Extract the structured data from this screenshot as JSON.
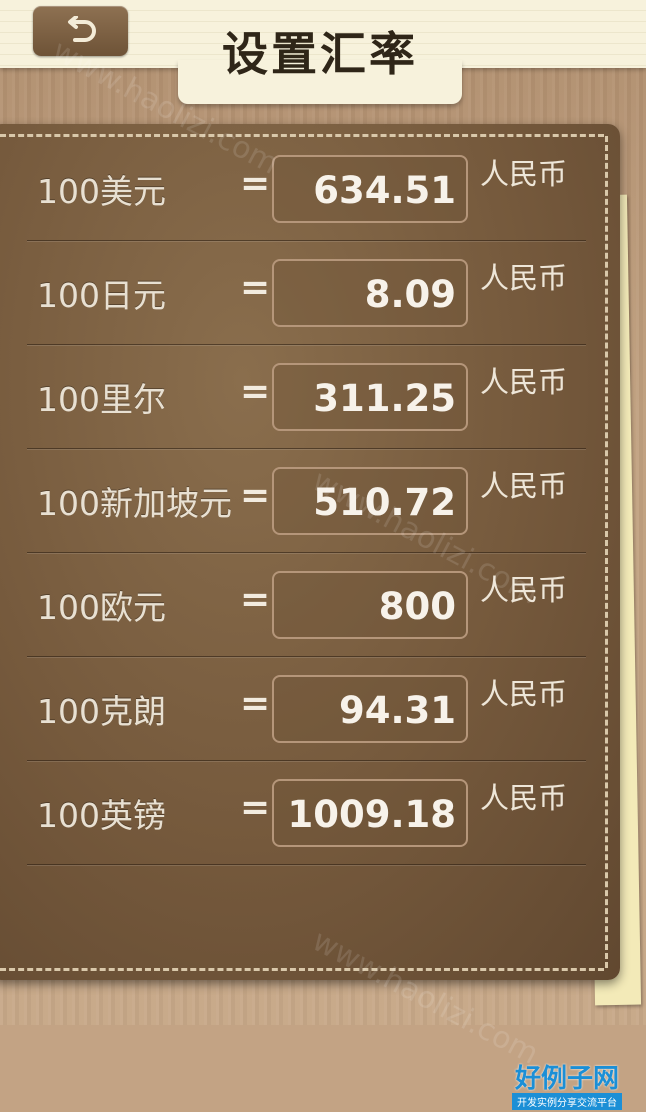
{
  "header": {
    "title": "设置汇率",
    "back_icon": "back-arrow-icon"
  },
  "rates": [
    {
      "currency": "100美元",
      "equals": "=",
      "value": "634.51",
      "unit": "人民币"
    },
    {
      "currency": "100日元",
      "equals": "=",
      "value": "8.09",
      "unit": "人民币"
    },
    {
      "currency": "100里尔",
      "equals": "=",
      "value": "311.25",
      "unit": "人民币"
    },
    {
      "currency": "100新加坡元",
      "equals": "=",
      "value": "510.72",
      "unit": "人民币"
    },
    {
      "currency": "100欧元",
      "equals": "=",
      "value": "800",
      "unit": "人民币"
    },
    {
      "currency": "100克朗",
      "equals": "=",
      "value": "94.31",
      "unit": "人民币"
    },
    {
      "currency": "100英镑",
      "equals": "=",
      "value": "1009.18",
      "unit": "人民币"
    }
  ],
  "watermark": "www.haolizi.com",
  "brand": {
    "name": "好例子网",
    "tagline": "开发实例分享交流平台"
  },
  "colors": {
    "leather": "#75593c",
    "header_paper": "#f7f2dc",
    "title_text": "#2f2618",
    "value_text": "#f7f2ea",
    "brand_blue": "#1b8fd6"
  }
}
